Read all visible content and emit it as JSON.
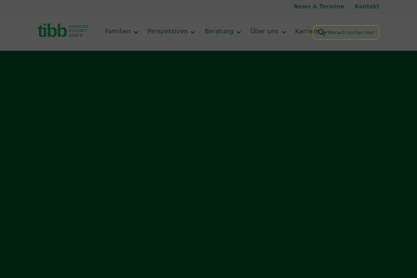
{
  "topbar": {
    "links": [
      "News & Termine",
      "Kontakt"
    ]
  },
  "logo": {
    "word": "tibb",
    "tagline": [
      "CHANCEN",
      "ZUKUNFT",
      "GEBEN"
    ]
  },
  "nav": {
    "items": [
      "Familien",
      "Perspektiven",
      "Beratung",
      "Über uns",
      "Karriere"
    ]
  },
  "search": {
    "placeholder": "Wonach suchen Sie?",
    "icon": "search-icon"
  },
  "colors": {
    "overlay_page": "#00210f",
    "header_bg": "#555555",
    "brand_green": "#0c3d20",
    "search_border": "#6f7a1e"
  }
}
